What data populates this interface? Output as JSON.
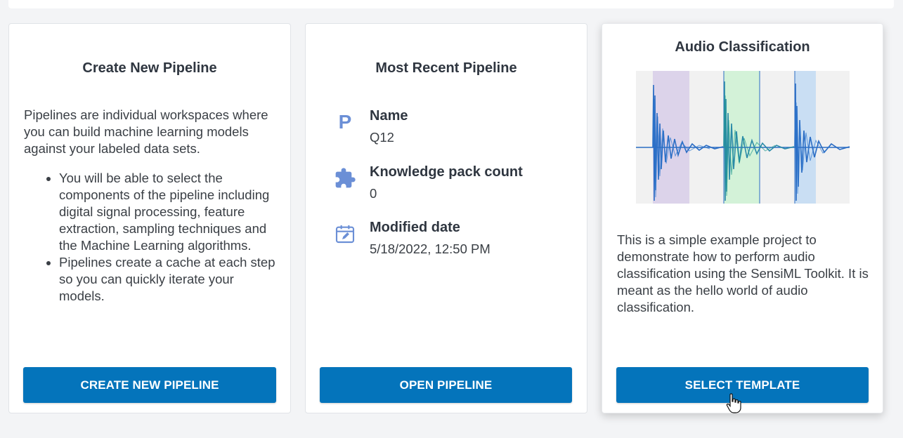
{
  "cards": [
    {
      "title": "Create New Pipeline",
      "description": "Pipelines are individual workspaces where you can build machine learning models against your labeled data sets.",
      "bullets": [
        "You will be able to select the components of the pipeline including digital signal processing, feature extraction, sampling techniques and the Machine Learning algorithms.",
        "Pipelines create a cache at each step so you can quickly iterate your models."
      ],
      "button": "CREATE NEW PIPELINE"
    },
    {
      "title": "Most Recent Pipeline",
      "fields": [
        {
          "label": "Name",
          "value": "Q12",
          "icon": "p-letter-icon"
        },
        {
          "label": "Knowledge pack count",
          "value": "0",
          "icon": "puzzle-icon"
        },
        {
          "label": "Modified date",
          "value": "5/18/2022, 12:50 PM",
          "icon": "calendar-edit-icon"
        }
      ],
      "icon_letter": "P",
      "button": "OPEN PIPELINE"
    },
    {
      "title": "Audio Classification",
      "description": "This is a simple example project to demonstrate how to perform audio classification using the SensiML Toolkit. It is meant as the hello world of audio classification.",
      "button": "SELECT TEMPLATE",
      "image": "audio-waveform-image"
    }
  ],
  "colors": {
    "primary_button": "#0474bb",
    "icon": "#6b8fd6",
    "segment_purple": "#dcd3ea",
    "segment_green": "#d3f2d8",
    "segment_blue": "#c9def3",
    "waveform": "#2b6dc4"
  }
}
